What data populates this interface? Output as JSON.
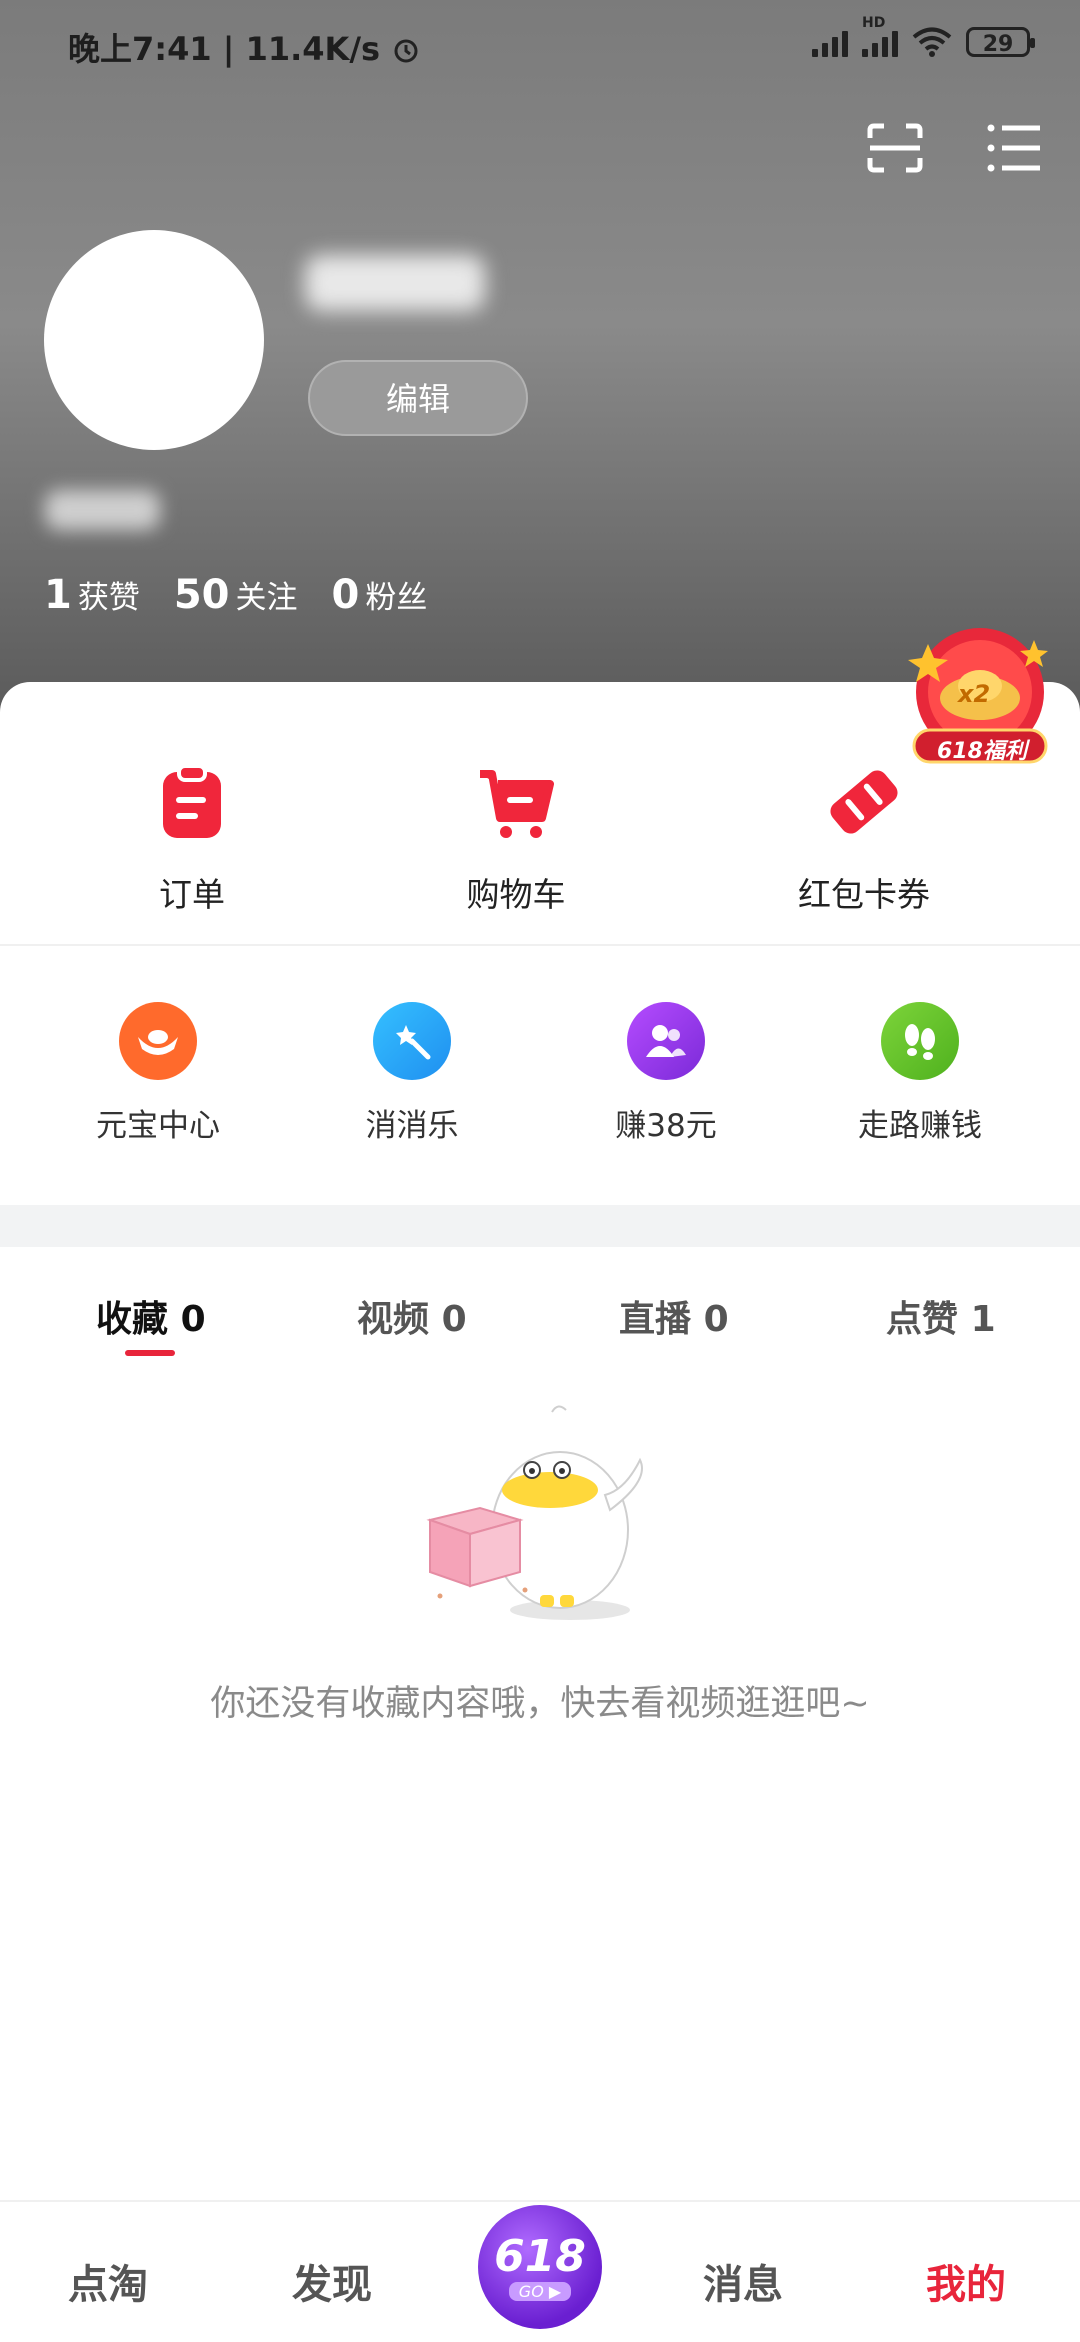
{
  "status_bar": {
    "time_speed": "晚上7:41 | 11.4K/s",
    "battery": "29",
    "hd_label": "HD"
  },
  "header": {
    "edit_label": "编辑",
    "stats": [
      {
        "num": "1",
        "label": "获赞"
      },
      {
        "num": "50",
        "label": "关注"
      },
      {
        "num": "0",
        "label": "粉丝"
      }
    ]
  },
  "shortcuts_primary": [
    {
      "label": "订单",
      "icon": "order-icon"
    },
    {
      "label": "购物车",
      "icon": "cart-icon"
    },
    {
      "label": "红包卡券",
      "icon": "coupon-icon"
    }
  ],
  "shortcuts_secondary": [
    {
      "label": "元宝中心",
      "icon": "ingot-icon",
      "color": "#ff6a2c"
    },
    {
      "label": "消消乐",
      "icon": "magic-wand-icon",
      "color": "#2aa8f5"
    },
    {
      "label": "赚38元",
      "icon": "users-icon",
      "color": "#9b3be6"
    },
    {
      "label": "走路赚钱",
      "icon": "footprints-icon",
      "color": "#6cc52a"
    }
  ],
  "badge": {
    "multiplier": "x2",
    "label": "618福利"
  },
  "tabs": [
    {
      "label": "收藏",
      "count": "0"
    },
    {
      "label": "视频",
      "count": "0"
    },
    {
      "label": "直播",
      "count": "0"
    },
    {
      "label": "点赞",
      "count": "1"
    }
  ],
  "empty_message": "你还没有收藏内容哦，快去看视频逛逛吧~",
  "nav": {
    "items": [
      "点淘",
      "发现",
      "消息",
      "我的"
    ],
    "center_label": "618",
    "center_sub": "GO ▶"
  },
  "colors": {
    "accent": "#e8253b",
    "header_gray": "#808080"
  }
}
